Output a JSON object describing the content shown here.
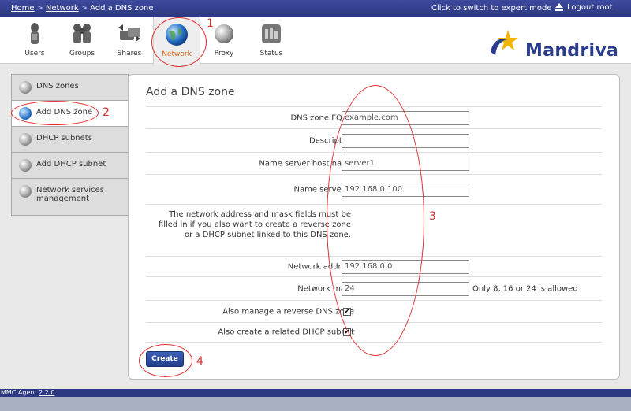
{
  "breadcrumb": {
    "home": "Home",
    "network": "Network",
    "current": "Add a DNS zone"
  },
  "topbar": {
    "expert_link": "Click to switch to expert mode",
    "logout": "Logout root"
  },
  "modules": [
    {
      "label": "Users",
      "icon": "users-icon"
    },
    {
      "label": "Groups",
      "icon": "groups-icon"
    },
    {
      "label": "Shares",
      "icon": "shares-icon"
    },
    {
      "label": "Network",
      "icon": "network-globe-icon",
      "active": true
    },
    {
      "label": "Proxy",
      "icon": "proxy-icon"
    },
    {
      "label": "Status",
      "icon": "status-icon"
    }
  ],
  "logo": {
    "text": "Mandriva"
  },
  "sidebar": {
    "items": [
      {
        "label": "DNS zones"
      },
      {
        "label": "Add DNS zone",
        "active": true
      },
      {
        "label": "DHCP subnets"
      },
      {
        "label": "Add DHCP subnet"
      },
      {
        "label": "Network services management"
      }
    ]
  },
  "form": {
    "title": "Add a DNS zone",
    "fqdn_label": "DNS zone FQDN",
    "fqdn_value": "example.com",
    "description_label": "Description",
    "description_value": "",
    "ns_host_label": "Name server host name",
    "ns_host_value": "server1",
    "ns_ip_label": "Name server IP",
    "ns_ip_value": "192.168.0.100",
    "note": "The network address and mask fields must be filled in if you also want to create a reverse zone or a DHCP subnet linked to this DNS zone.",
    "net_addr_label": "Network address",
    "net_addr_value": "192.168.0.0",
    "net_mask_label": "Network mask",
    "net_mask_value": "24",
    "net_mask_hint": "Only 8, 16 or 24 is allowed",
    "reverse_label": "Also manage a reverse DNS zone",
    "reverse_checked": true,
    "dhcp_label": "Also create a related DHCP subnet",
    "dhcp_checked": true,
    "create_label": "Create"
  },
  "annotations": {
    "n1": "1",
    "n2": "2",
    "n3": "3",
    "n4": "4"
  },
  "footer": {
    "prefix": "MMC Agent ",
    "version": "2.2.0"
  },
  "colors": {
    "topbar": "#2c3882",
    "annotation": "#e03030",
    "active_module": "#e06010"
  }
}
